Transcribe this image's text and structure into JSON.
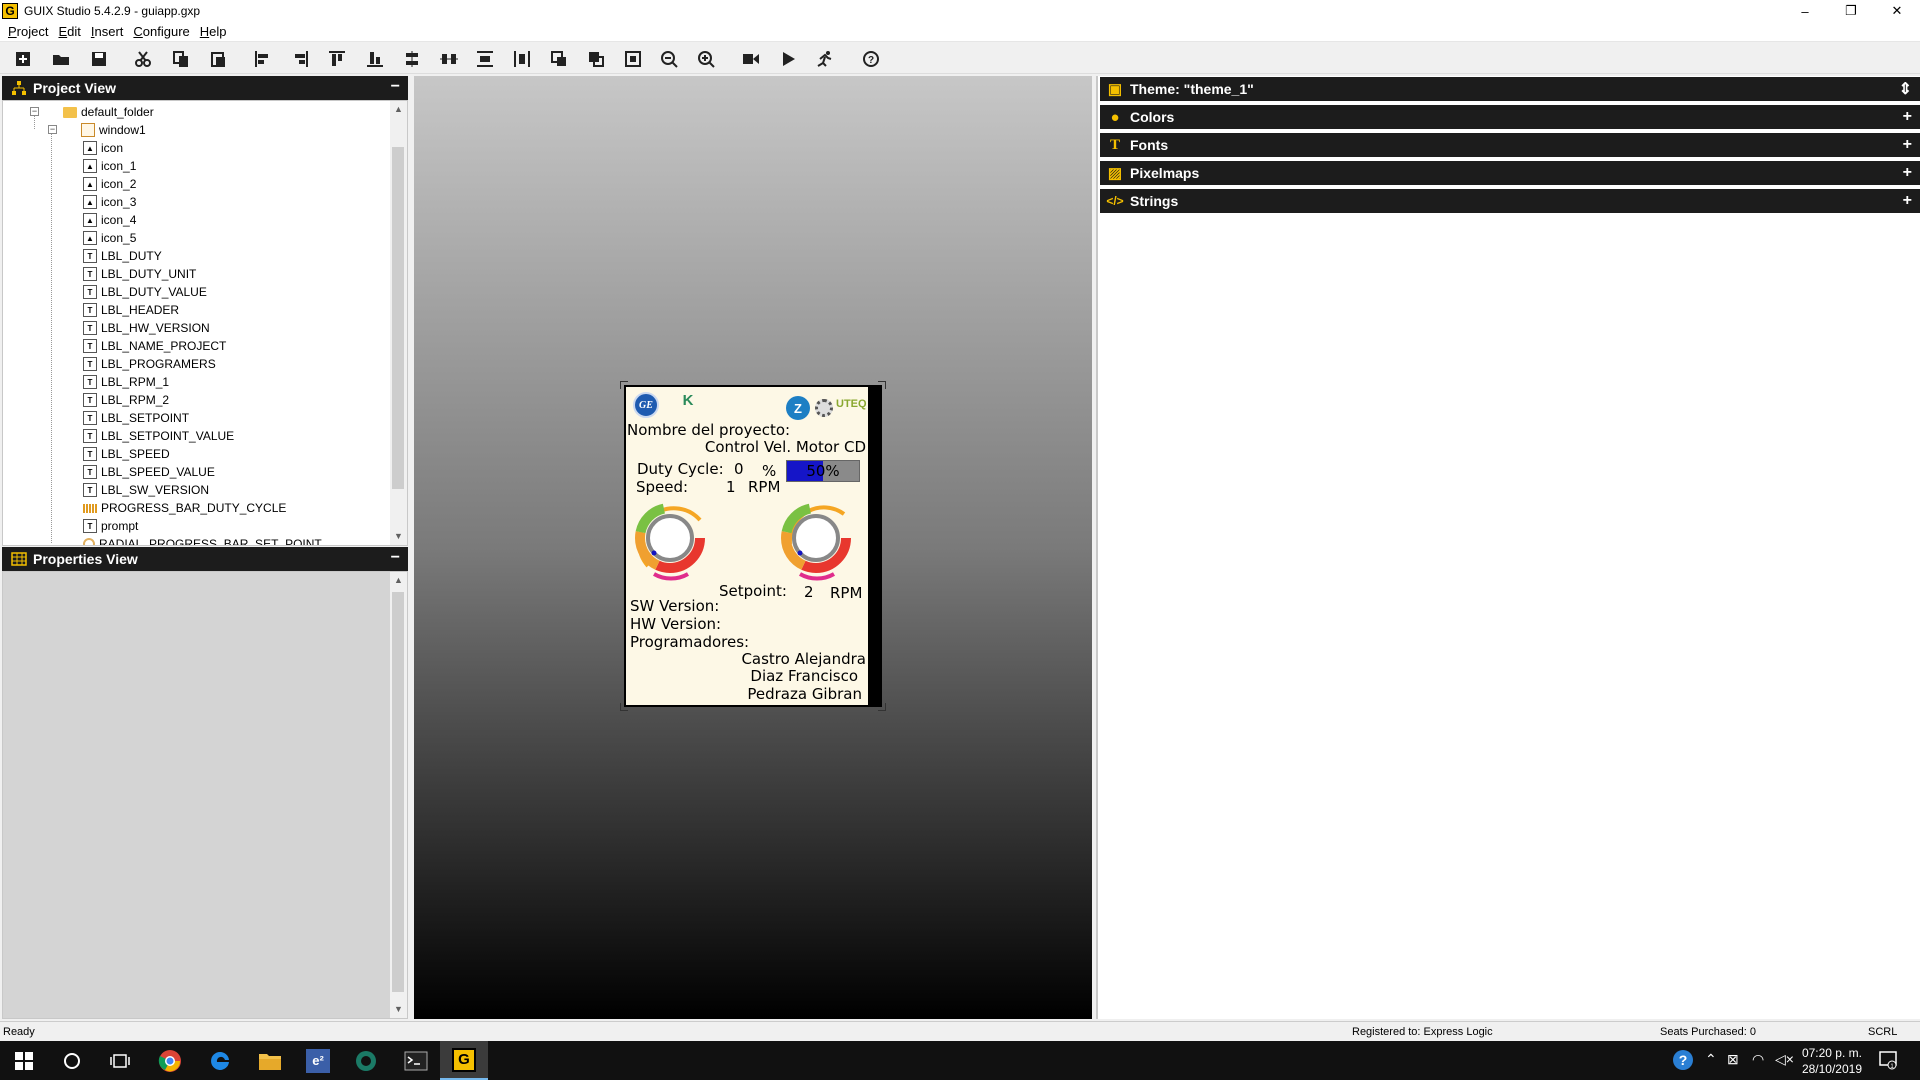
{
  "window": {
    "title": "GUIX Studio 5.4.2.9 - guiapp.gxp",
    "app_icon_letter": "G",
    "controls": {
      "minimize": "–",
      "restore": "❐",
      "close": "✕"
    }
  },
  "menu": [
    "Project",
    "Edit",
    "Insert",
    "Configure",
    "Help"
  ],
  "toolbar": {
    "icons": [
      "new-project-icon",
      "open-icon",
      "save-icon",
      "cut-icon",
      "copy-icon",
      "paste-icon",
      "align-left-icon",
      "align-right-icon",
      "align-top-icon",
      "align-bottom-icon",
      "equal-width-icon",
      "equal-height-icon",
      "hspace-icon",
      "vspace-icon",
      "move-to-front-icon",
      "move-to-back-icon",
      "size-to-fit-icon",
      "zoom-out-icon",
      "zoom-in-icon",
      "record-macro-icon",
      "run-icon",
      "run-app-icon",
      "help-icon"
    ]
  },
  "project_view": {
    "title": "Project View",
    "collapse": "−",
    "tree": [
      {
        "label": "default_folder",
        "kind": "folder",
        "level": 0
      },
      {
        "label": "window1",
        "kind": "window",
        "level": 1
      },
      {
        "label": "icon",
        "kind": "icon",
        "level": 2
      },
      {
        "label": "icon_1",
        "kind": "icon",
        "level": 2
      },
      {
        "label": "icon_2",
        "kind": "icon",
        "level": 2
      },
      {
        "label": "icon_3",
        "kind": "icon",
        "level": 2
      },
      {
        "label": "icon_4",
        "kind": "icon",
        "level": 2
      },
      {
        "label": "icon_5",
        "kind": "icon",
        "level": 2
      },
      {
        "label": "LBL_DUTY",
        "kind": "text",
        "level": 2
      },
      {
        "label": "LBL_DUTY_UNIT",
        "kind": "text",
        "level": 2
      },
      {
        "label": "LBL_DUTY_VALUE",
        "kind": "text",
        "level": 2
      },
      {
        "label": "LBL_HEADER",
        "kind": "text",
        "level": 2
      },
      {
        "label": "LBL_HW_VERSION",
        "kind": "text",
        "level": 2
      },
      {
        "label": "LBL_NAME_PROJECT",
        "kind": "text",
        "level": 2
      },
      {
        "label": "LBL_PROGRAMERS",
        "kind": "text",
        "level": 2
      },
      {
        "label": "LBL_RPM_1",
        "kind": "text",
        "level": 2
      },
      {
        "label": "LBL_RPM_2",
        "kind": "text",
        "level": 2
      },
      {
        "label": "LBL_SETPOINT",
        "kind": "text",
        "level": 2
      },
      {
        "label": "LBL_SETPOINT_VALUE",
        "kind": "text",
        "level": 2
      },
      {
        "label": "LBL_SPEED",
        "kind": "text",
        "level": 2
      },
      {
        "label": "LBL_SPEED_VALUE",
        "kind": "text",
        "level": 2
      },
      {
        "label": "LBL_SW_VERSION",
        "kind": "text",
        "level": 2
      },
      {
        "label": "PROGRESS_BAR_DUTY_CYCLE",
        "kind": "pbar",
        "level": 2
      },
      {
        "label": "prompt",
        "kind": "text",
        "level": 2
      },
      {
        "label": "RADIAL_PROGRESS_BAR_SET_POINT",
        "kind": "radial",
        "level": 2
      }
    ]
  },
  "properties_view": {
    "title": "Properties View",
    "collapse": "−"
  },
  "device": {
    "project_label": "Nombre del proyecto:",
    "project_name": "Control Vel. Motor CD",
    "duty_label": "Duty Cycle:",
    "duty_value": "0",
    "duty_unit": "%",
    "progress_text": "50%",
    "progress_value": 0.5,
    "speed_label": "Speed:",
    "speed_value": "1",
    "speed_unit": "RPM",
    "setpoint_label": "Setpoint:",
    "setpoint_value": "2",
    "setpoint_unit": "RPM",
    "sw_version": "SW Version:",
    "hw_version": "HW Version:",
    "programmers_label": "Programadores:",
    "programmers": [
      "Castro Alejandra",
      "Diaz Francisco",
      "Pedraza Gibran"
    ],
    "logos": [
      "ge-logo",
      "k-logo",
      "z-logo",
      "gear-logo",
      "uteq-logo"
    ],
    "logo_text": {
      "ge": "GE",
      "k": "K",
      "z": "Z",
      "uteq": "UTEQ"
    }
  },
  "resources": {
    "theme_title": "Theme: \"theme_1\"",
    "sections": [
      "Colors",
      "Fonts",
      "Pixelmaps",
      "Strings"
    ],
    "expand": "+",
    "theme_spin": "⇕"
  },
  "status": {
    "left": "Ready",
    "registered": "Registered to: Express Logic",
    "seats": "Seats Purchased: 0",
    "scrl": "SCRL"
  },
  "taskbar": {
    "apps": [
      "windows-start-icon",
      "cortana-icon",
      "task-view-icon",
      "chrome-icon",
      "edge-icon",
      "file-explorer-icon",
      "e2-studio-icon",
      "app-icon",
      "terminal-icon",
      "guix-studio-icon"
    ],
    "e2_label": "e²",
    "guix_label": "G",
    "time": "07:20 p. m.",
    "date": "28/10/2019",
    "notif_count": "1"
  }
}
